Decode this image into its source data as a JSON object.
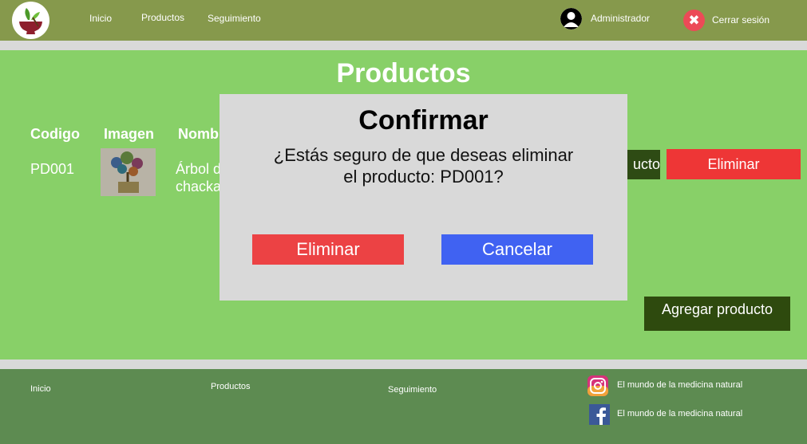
{
  "header": {
    "nav": [
      "Inicio",
      "Productos",
      "Seguimiento"
    ],
    "user_name": "Administrador",
    "logout_label": "Cerrar sesión"
  },
  "main": {
    "title": "Productos",
    "columns": [
      "Codigo",
      "Imagen",
      "Nomb"
    ],
    "row": {
      "code": "PD001",
      "name_line1": "Árbol d",
      "name_line2": "chacka",
      "edit_label": "ucto",
      "delete_label": "Eliminar"
    },
    "add_label": "Agregar producto"
  },
  "modal": {
    "title": "Confirmar",
    "message": "¿Estás seguro de que deseas eliminar el producto: PD001?",
    "confirm_label": "Eliminar",
    "cancel_label": "Cancelar"
  },
  "footer": {
    "links": [
      "Inicio",
      "Productos",
      "Seguimiento"
    ],
    "instagram_text": "El mundo de la medicina natural",
    "facebook_text": "El mundo de la medicina natural"
  }
}
